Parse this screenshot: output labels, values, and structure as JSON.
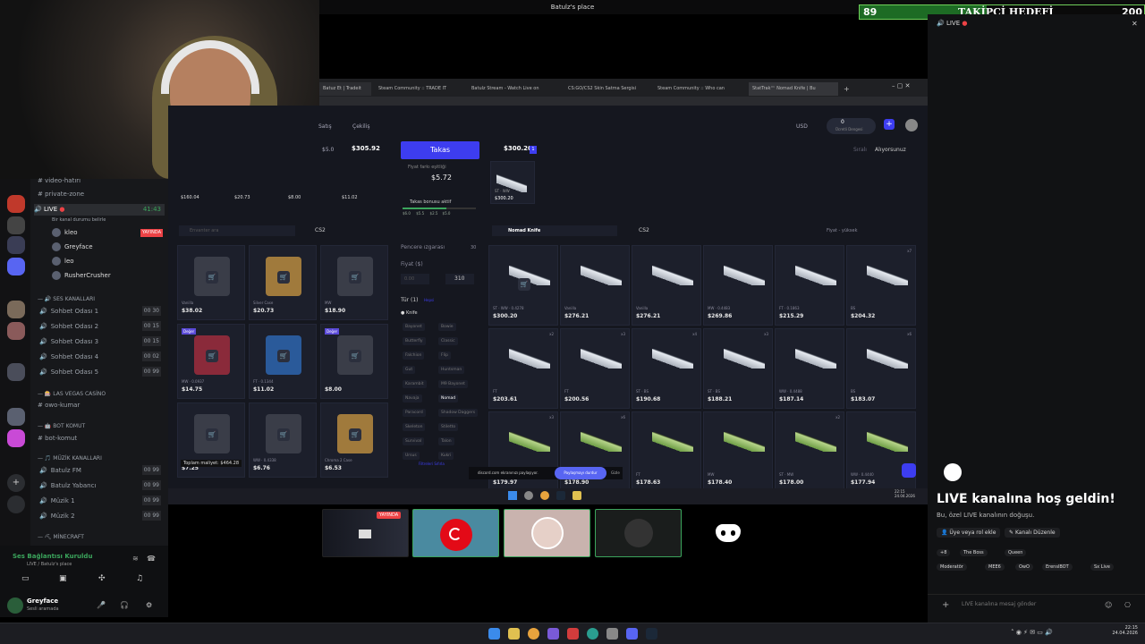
{
  "window_title": "Batulz's place",
  "follower_goal": {
    "current": "89",
    "title": "TAKİPÇİ HEDEFİ",
    "target": "200",
    "progress": 0.445
  },
  "webcam": {
    "label": "webcam-feed"
  },
  "browser": {
    "tabs": [
      "Batuz Et | Tradeit",
      "Steam Community :: TRADE IT",
      "Batulz Stream - Watch Live on",
      "CS:GO/CS2 Skin Satma Sergisi",
      "Steam Community :: Who can",
      "StatTrak™ Nomad Knife | Bu"
    ],
    "new_tab": "+",
    "nav": [
      "Satış",
      "Çekiliş"
    ],
    "currency": "USD",
    "balance": "0",
    "balance_label": "Ücretli Dengesi"
  },
  "trade": {
    "left_total": "$305.92",
    "left_small": "$5.0",
    "right_total": "$300.20",
    "right_count": "1",
    "button": "Takas",
    "diff_label": "Fiyat farkı eşitliği",
    "diff_value": "$5.72",
    "bonus_label": "Takas bonusu aktif",
    "bonus_steps": [
      "$6.0",
      "$5.5",
      "$2.5",
      "$5.0"
    ],
    "right_item": {
      "tag": "ST · WW",
      "price": "$300.20"
    },
    "sort_left": "Sıralı",
    "sort_right": "Alıyorsunuz"
  },
  "left_inventory": {
    "search_placeholder": "Envanter ara",
    "game": "CS2",
    "top_row_prices": [
      "$160.04",
      "$20.73",
      "$8.00",
      "$11.02"
    ],
    "items": [
      {
        "price": "$38.02",
        "tag": "Vanilla",
        "badge": ""
      },
      {
        "price": "$20.73",
        "tag": "Silver Case",
        "badge": ""
      },
      {
        "price": "$18.90",
        "tag": "MW",
        "badge": ""
      },
      {
        "price": "$14.75",
        "tag": "MW · 0.0937",
        "badge": "Değer"
      },
      {
        "price": "$11.02",
        "tag": "FT · 0.1344",
        "badge": ""
      },
      {
        "price": "$8.00",
        "tag": "",
        "badge": "Değer"
      },
      {
        "price": "$7.25",
        "tag": "",
        "badge": ""
      },
      {
        "price": "$6.76",
        "tag": "WW · 0.4338",
        "badge": ""
      },
      {
        "price": "$6.53",
        "tag": "Chroma 2 Case",
        "badge": ""
      }
    ],
    "total_label": "Toplam maliyet: $464.28"
  },
  "filters": {
    "grid_label": "Pencere ızgarası",
    "grid_count": "30",
    "price_label": "Fiyat ($)",
    "price_min": "0.00",
    "price_max": "310",
    "type_label": "Tür (1)",
    "type_clear": "Hepsi",
    "knife_label": "Knife",
    "knife_types": [
      "Bayonet",
      "Bowie",
      "Butterfly",
      "Classic",
      "Falchion",
      "Flip",
      "Gut",
      "Huntsman",
      "Karambit",
      "M9 Bayonet",
      "Navaja",
      "Nomad",
      "Paracord",
      "Shadow Daggers",
      "Skeleton",
      "Stiletto",
      "Survival",
      "Talon",
      "Ursus",
      "Kukri"
    ],
    "reset": "Filtreleri Sıfırla"
  },
  "market": {
    "search_value": "Nomad Knife",
    "game": "CS2",
    "sort": "Fiyat - yüksek",
    "items": [
      {
        "price": "$300.20",
        "tag": "ST · WW · 0.4278",
        "count": "",
        "green": false
      },
      {
        "price": "$276.21",
        "tag": "Vanilla",
        "count": "",
        "green": false
      },
      {
        "price": "$276.21",
        "tag": "Vanilla",
        "count": "",
        "green": false
      },
      {
        "price": "$269.86",
        "tag": "MW · 0.4483",
        "count": "",
        "green": false
      },
      {
        "price": "$215.29",
        "tag": "FT · 0.1863",
        "count": "",
        "green": false
      },
      {
        "price": "$204.32",
        "tag": "BS",
        "count": "x7",
        "green": false
      },
      {
        "price": "$203.61",
        "tag": "FT",
        "count": "x2",
        "green": false
      },
      {
        "price": "$200.56",
        "tag": "FT",
        "count": "x3",
        "green": false
      },
      {
        "price": "$190.68",
        "tag": "ST · BS",
        "count": "x4",
        "green": false
      },
      {
        "price": "$188.21",
        "tag": "ST · BS",
        "count": "x3",
        "green": false
      },
      {
        "price": "$187.14",
        "tag": "WW · 0.4488",
        "count": "",
        "green": false
      },
      {
        "price": "$183.07",
        "tag": "BS",
        "count": "x6",
        "green": false
      },
      {
        "price": "$179.97",
        "tag": "",
        "count": "x3",
        "green": true
      },
      {
        "price": "$178.90",
        "tag": "",
        "count": "x6",
        "green": true
      },
      {
        "price": "$178.63",
        "tag": "FT",
        "count": "",
        "green": true
      },
      {
        "price": "$178.40",
        "tag": "MW",
        "count": "",
        "green": true
      },
      {
        "price": "$178.00",
        "tag": "ST · MW",
        "count": "x2",
        "green": true
      },
      {
        "price": "$177.94",
        "tag": "WW · 0.4440",
        "count": "",
        "green": true
      }
    ]
  },
  "share_banner": {
    "text": "discord.com ekranınızı paylaşıyor.",
    "stop": "Paylaşmayı durdur",
    "hide": "Gizle"
  },
  "inner_taskbar": {
    "time": "22:15",
    "date": "24.04.2026"
  },
  "discord": {
    "channels": {
      "video_hatiri": "video-hatırı",
      "private_zone": "private-zone",
      "live_name": "LIVE",
      "live_time": "41:43",
      "live_desc": "Bir kanal durumu belirle",
      "live_members": [
        {
          "name": "kleo",
          "live": "YAYINDA"
        },
        {
          "name": "Greyface",
          "live": ""
        },
        {
          "name": "leo",
          "live": ""
        },
        {
          "name": "RusherCrusher",
          "live": ""
        }
      ],
      "cat_ses": "SES KANALLARI",
      "voice": [
        {
          "name": "Sohbet Odası 1",
          "a": "00",
          "b": "30"
        },
        {
          "name": "Sohbet Odası 2",
          "a": "00",
          "b": "15"
        },
        {
          "name": "Sohbet Odası 3",
          "a": "00",
          "b": "15"
        },
        {
          "name": "Sohbet Odası 4",
          "a": "00",
          "b": "02"
        },
        {
          "name": "Sohbet Odası 5",
          "a": "00",
          "b": "99"
        }
      ],
      "cat_vegas": "LAS VEGAS CASİNO",
      "owo": "owo-kumar",
      "cat_bot": "BOT KOMUT",
      "bot": "bot-komut",
      "cat_muzik": "MÜZİK KANALLARI",
      "music": [
        {
          "name": "Batulz FM",
          "a": "00",
          "b": "99"
        },
        {
          "name": "Batulz Yabancı",
          "a": "00",
          "b": "99"
        },
        {
          "name": "Müzik 1",
          "a": "00",
          "b": "99"
        },
        {
          "name": "Müzik 2",
          "a": "00",
          "b": "99"
        }
      ],
      "cat_minecraft": "MİNECRAFT"
    },
    "voice_status": {
      "title": "Ses Bağlantısı Kuruldu",
      "sub": "LIVE / Batulz's place"
    },
    "user": {
      "name": "Greyface",
      "status": "Sesli aramada"
    },
    "stream_thumbs": {
      "live_badge": "YAYINDA"
    },
    "right": {
      "header": "LIVE",
      "welcome": "LIVE kanalına hoş geldin!",
      "welcome_sub": "Bu, özel LIVE kanalının doğuşu.",
      "add_member": "Üye veya rol ekle",
      "edit_channel": "Kanalı Düzenle",
      "roles_row1": [
        "+8",
        "The Boss",
        "Queen"
      ],
      "roles_row2": [
        "Moderatör",
        "MEE6",
        "OwO",
        "ErenslBOT",
        "Sx Live"
      ],
      "input_placeholder": "LIVE kanalına mesaj gönder"
    }
  },
  "os_taskbar": {
    "time": "22:15",
    "date": "24.04.2026"
  },
  "colors": {
    "accent": "#3d3df0",
    "live_red": "#ed4245",
    "discord_green": "#3ba55c",
    "goal_green": "#6fcf5a"
  }
}
